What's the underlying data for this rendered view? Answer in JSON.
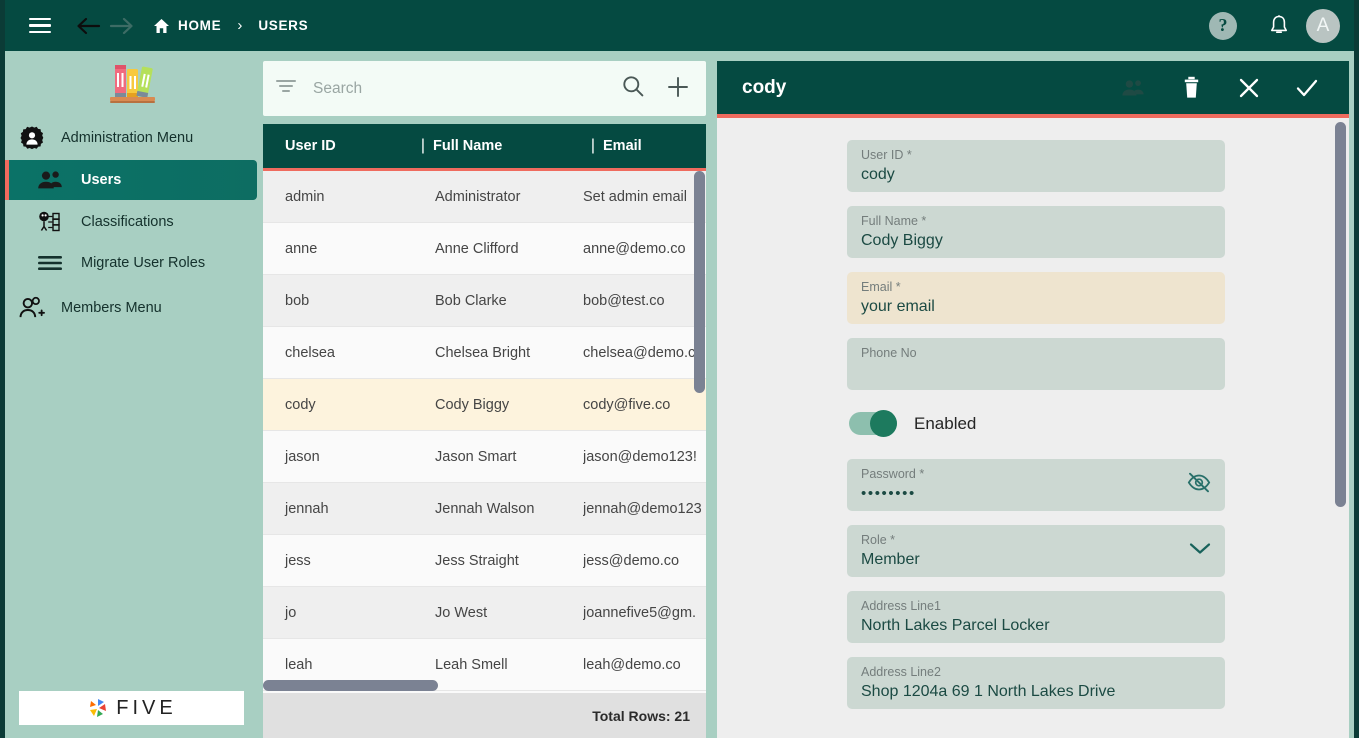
{
  "topbar": {
    "menu_icon": "hamburger-icon",
    "back_icon": "arrow-left-icon",
    "forward_icon": "arrow-right-icon",
    "home_icon": "home-icon",
    "home_label": "HOME",
    "separator": "›",
    "current_label": "USERS",
    "help_glyph": "?",
    "bell_icon": "bell-icon",
    "avatar_initial": "A"
  },
  "sidebar": {
    "logo_icon": "books-logo",
    "groups": [
      {
        "label": "Administration Menu",
        "icon": "gear-person-icon"
      }
    ],
    "items": [
      {
        "label": "Users",
        "icon": "users-icon",
        "active": true
      },
      {
        "label": "Classifications",
        "icon": "classifications-icon",
        "active": false
      },
      {
        "label": "Migrate User Roles",
        "icon": "list-lines-icon",
        "active": false
      }
    ],
    "members_group": {
      "label": "Members Menu",
      "icon": "person-add-icon"
    },
    "brand": {
      "name": "FIVE",
      "mark": "five-pinwheel-icon"
    }
  },
  "search": {
    "filter_icon": "filter-icon",
    "placeholder": "Search",
    "value": "",
    "search_icon": "search-icon",
    "add_icon": "plus-icon"
  },
  "table": {
    "columns": [
      "User ID",
      "Full Name",
      "Email"
    ],
    "divider": "|",
    "rows": [
      {
        "user_id": "admin",
        "full_name": "Administrator",
        "email": "Set admin email",
        "selected": false
      },
      {
        "user_id": "anne",
        "full_name": "Anne Clifford",
        "email": "anne@demo.co",
        "selected": false
      },
      {
        "user_id": "bob",
        "full_name": "Bob Clarke",
        "email": "bob@test.co",
        "selected": false
      },
      {
        "user_id": "chelsea",
        "full_name": "Chelsea Bright",
        "email": "chelsea@demo.co",
        "selected": false
      },
      {
        "user_id": "cody",
        "full_name": "Cody Biggy",
        "email": "cody@five.co",
        "selected": true
      },
      {
        "user_id": "jason",
        "full_name": "Jason Smart",
        "email": "jason@demo123!",
        "selected": false
      },
      {
        "user_id": "jennah",
        "full_name": "Jennah Walson",
        "email": "jennah@demo123",
        "selected": false
      },
      {
        "user_id": "jess",
        "full_name": "Jess Straight",
        "email": "jess@demo.co",
        "selected": false
      },
      {
        "user_id": "jo",
        "full_name": "Jo West",
        "email": "joannefive5@gm.",
        "selected": false
      },
      {
        "user_id": "leah",
        "full_name": "Leah Smell",
        "email": "leah@demo.co",
        "selected": false
      }
    ],
    "footer_total": "Total Rows: 21"
  },
  "detail": {
    "title": "cody",
    "actions": [
      {
        "name": "members-icon",
        "glyph": "👥",
        "disabled": true
      },
      {
        "name": "delete-icon",
        "glyph": "trash",
        "disabled": false
      },
      {
        "name": "close-icon",
        "glyph": "✕",
        "disabled": false
      },
      {
        "name": "save-icon",
        "glyph": "✓",
        "disabled": false
      }
    ],
    "fields": [
      {
        "label": "User ID *",
        "value": "cody",
        "modified": false,
        "adorn": null
      },
      {
        "label": "Full Name *",
        "value": "Cody Biggy",
        "modified": false,
        "adorn": null
      },
      {
        "label": "Email *",
        "value": "your email",
        "modified": true,
        "adorn": null
      },
      {
        "label": "Phone No",
        "value": "",
        "modified": false,
        "adorn": null
      }
    ],
    "toggle": {
      "label": "Enabled",
      "on": true
    },
    "fields2": [
      {
        "label": "Password *",
        "value": "••••••••",
        "modified": false,
        "adorn": "eye-off-icon",
        "dots": true
      },
      {
        "label": "Role *",
        "value": "Member",
        "modified": false,
        "adorn": "chevron-down-icon"
      },
      {
        "label": "Address Line1",
        "value": "North Lakes Parcel Locker",
        "modified": false,
        "adorn": null
      },
      {
        "label": "Address Line2",
        "value": "Shop 1204a 69 1 North Lakes Drive",
        "modified": false,
        "adorn": null
      }
    ]
  },
  "colors": {
    "header_green": "#054a41",
    "sidebar_green": "#a8cfc2",
    "accent_coral": "#ef6b5e",
    "active_item": "#0b7267",
    "field_bg": "#ccd8d2",
    "field_modified_bg": "#eee4cf",
    "row_selected": "#fdf3dd",
    "scrollbar": "#7b8293"
  }
}
